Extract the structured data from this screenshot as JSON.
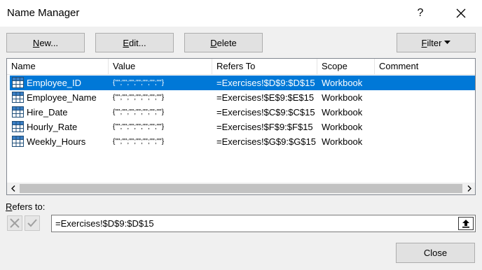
{
  "window": {
    "title": "Name Manager",
    "help_label": "?"
  },
  "toolbar": {
    "new_label": "New...",
    "new_mnemonic": "N",
    "new_rest": "ew...",
    "edit_label": "Edit...",
    "edit_mnemonic": "E",
    "edit_rest": "dit...",
    "delete_label": "Delete",
    "delete_mnemonic": "D",
    "delete_rest": "elete",
    "filter_label": "Filter",
    "filter_mnemonic": "F",
    "filter_rest": "ilter"
  },
  "table": {
    "columns": [
      "Name",
      "Value",
      "Refers To",
      "Scope",
      "Comment"
    ],
    "rows": [
      {
        "name": "Employee_ID",
        "value": "{\"\";\"\";\"\";\"\";\"\";\"\";\"\"}",
        "refers_to": "=Exercises!$D$9:$D$15",
        "scope": "Workbook",
        "comment": "",
        "selected": true
      },
      {
        "name": "Employee_Name",
        "value": "{\"\";\"\";\"\";\"\";\"\";\"\";\"\"}",
        "refers_to": "=Exercises!$E$9:$E$15",
        "scope": "Workbook",
        "comment": "",
        "selected": false
      },
      {
        "name": "Hire_Date",
        "value": "{\"\";\"\";\"\";\"\";\"\";\"\";\"\"}",
        "refers_to": "=Exercises!$C$9:$C$15",
        "scope": "Workbook",
        "comment": "",
        "selected": false
      },
      {
        "name": "Hourly_Rate",
        "value": "{\"\";\"\";\"\";\"\";\"\";\"\";\"\"}",
        "refers_to": "=Exercises!$F$9:$F$15",
        "scope": "Workbook",
        "comment": "",
        "selected": false
      },
      {
        "name": "Weekly_Hours",
        "value": "{\"\";\"\";\"\";\"\";\"\";\"\";\"\"}",
        "refers_to": "=Exercises!$G$9:$G$15",
        "scope": "Workbook",
        "comment": "",
        "selected": false
      }
    ]
  },
  "refers": {
    "label": "Refers to:",
    "mnemonic": "R",
    "rest": "efers to:",
    "value": "=Exercises!$D$9:$D$15"
  },
  "footer": {
    "close_label": "Close"
  },
  "colors": {
    "selection": "#0078d7",
    "button_bg": "#e1e1e1",
    "dialog_bg": "#f0f0f0"
  },
  "icons": {
    "row_icon": "named-range-table-icon",
    "close": "close-icon",
    "cancel": "cancel-x-icon",
    "ok": "confirm-check-icon",
    "collapse": "collapse-dialog-icon"
  }
}
